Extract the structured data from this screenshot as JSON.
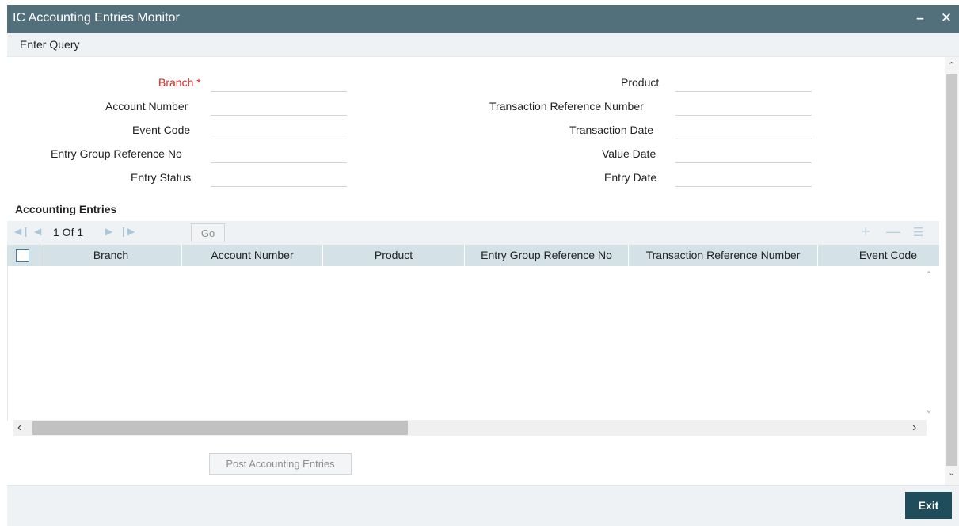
{
  "window": {
    "title": "IC Accounting Entries Monitor",
    "minimize_glyph": "–",
    "close_glyph": "✕"
  },
  "menu": {
    "enter_query": "Enter Query"
  },
  "query_form": {
    "left": {
      "branch": {
        "label": "Branch",
        "required_mark": "*",
        "value": ""
      },
      "account_number": {
        "label": "Account Number",
        "value": ""
      },
      "event_code": {
        "label": "Event Code",
        "value": ""
      },
      "entry_group_reference_no": {
        "label": "Entry Group Reference No",
        "value": ""
      },
      "entry_status": {
        "label": "Entry Status",
        "value": ""
      }
    },
    "right": {
      "product": {
        "label": "Product",
        "value": ""
      },
      "transaction_reference_number": {
        "label": "Transaction Reference Number",
        "value": ""
      },
      "transaction_date": {
        "label": "Transaction Date",
        "value": ""
      },
      "value_date": {
        "label": "Value Date",
        "value": ""
      },
      "entry_date": {
        "label": "Entry Date",
        "value": ""
      }
    }
  },
  "accounting_entries": {
    "section_title": "Accounting Entries",
    "pager": {
      "text": "1 Of 1",
      "go_label": "Go"
    },
    "columns": [
      "Branch",
      "Account Number",
      "Product",
      "Entry Group Reference No",
      "Transaction Reference Number",
      "Event Code"
    ],
    "rows": []
  },
  "icons": {
    "first_page": "first-page-icon",
    "prev_page": "prev-page-icon",
    "next_page": "next-page-icon",
    "last_page": "last-page-icon",
    "add_row": "plus-icon",
    "delete_row": "minus-icon",
    "single_view": "list-icon"
  },
  "actions": {
    "post_accounting_entries": "Post Accounting Entries",
    "exit": "Exit"
  },
  "colors": {
    "titlebar": "#52707c",
    "exit_button": "#1f4d5c",
    "required_label": "#d4251c",
    "grid_header": "#d4e2e8"
  }
}
